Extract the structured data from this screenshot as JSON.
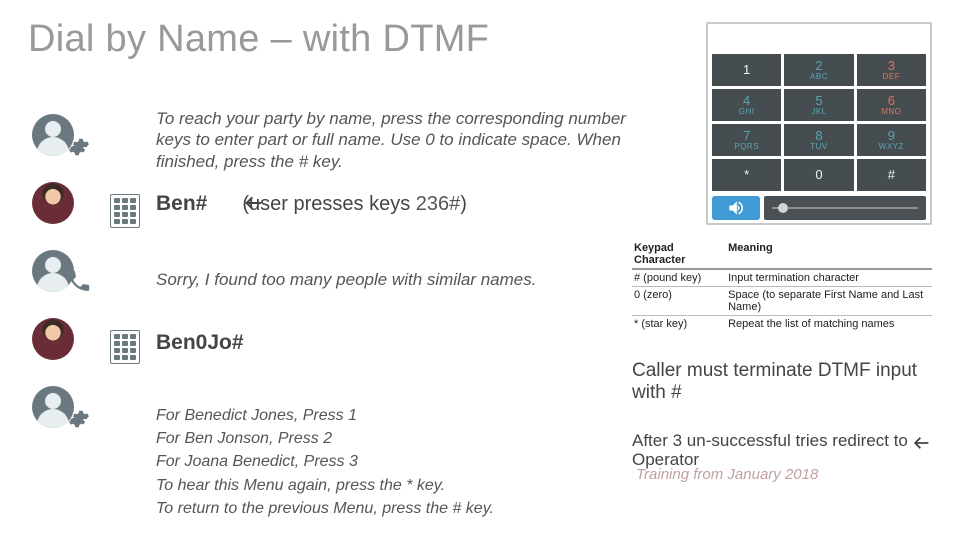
{
  "title": "Dial by Name – with DTMF",
  "prompt_text": "To reach your party by name, press the corresponding number keys to enter part or full name. Use 0 to indicate space. When finished, press the # key.",
  "entry1": {
    "typed": "Ben#",
    "hint_prefix": "(user presses keys ",
    "digits": "236#",
    "hint_suffix": ")"
  },
  "sorry_text": "Sorry, I found too many people with similar names.",
  "entry2_typed": "Ben0Jo#",
  "menu_lines": [
    "For Benedict Jones, Press 1",
    "For Ben Jonson, Press 2",
    "For Joana Benedict, Press 3",
    "To hear this Menu again, press the * key.",
    "To return to the previous Menu, press the # key."
  ],
  "keypad": {
    "keys": [
      {
        "digit": "1",
        "letters": "",
        "variant": ""
      },
      {
        "digit": "2",
        "letters": "ABC",
        "variant": "cyan"
      },
      {
        "digit": "3",
        "letters": "DEF",
        "variant": "red"
      },
      {
        "digit": "4",
        "letters": "GHI",
        "variant": "cyan"
      },
      {
        "digit": "5",
        "letters": "JKL",
        "variant": "cyan"
      },
      {
        "digit": "6",
        "letters": "MNO",
        "variant": "red"
      },
      {
        "digit": "7",
        "letters": "PQRS",
        "variant": "cyan"
      },
      {
        "digit": "8",
        "letters": "TUV",
        "variant": "cyan"
      },
      {
        "digit": "9",
        "letters": "WXYZ",
        "variant": "cyan"
      },
      {
        "digit": "*",
        "letters": "",
        "variant": ""
      },
      {
        "digit": "0",
        "letters": "",
        "variant": ""
      },
      {
        "digit": "#",
        "letters": "",
        "variant": ""
      }
    ]
  },
  "meaning": {
    "headers": [
      "Keypad Character",
      "Meaning"
    ],
    "rows": [
      {
        "k": "# (pound key)",
        "m": "Input termination character"
      },
      {
        "k": "0 (zero)",
        "m": "Space (to separate First Name and Last Name)"
      },
      {
        "k": "* (star key)",
        "m": "Repeat the list of matching names"
      }
    ]
  },
  "note1": "Caller must terminate DTMF input with #",
  "note2": "After 3 un-successful tries redirect to Operator",
  "watermark": "Training from January 2018"
}
